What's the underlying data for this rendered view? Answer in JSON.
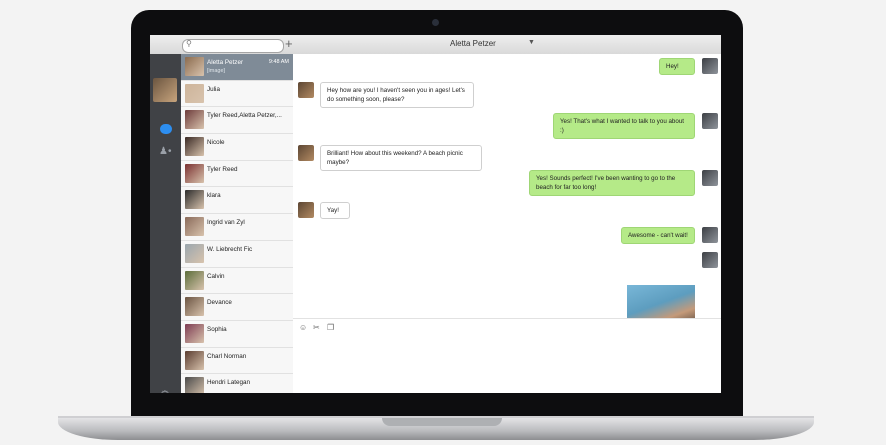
{
  "window": {
    "title": "Aletta Petzer"
  },
  "search": {
    "placeholder": ""
  },
  "conversations": [
    {
      "name": "Aletta Petzer",
      "preview": "[image]",
      "time": "9:48 AM",
      "active": true,
      "color": "#8b6b4e"
    },
    {
      "name": "Julia",
      "color": "#cdb49a"
    },
    {
      "name": "Tyler Reed,Aletta Petzer,...",
      "color": "#6d3b3b"
    },
    {
      "name": "Nicole",
      "color": "#3a2a25"
    },
    {
      "name": "Tyler Reed",
      "color": "#7a3030"
    },
    {
      "name": "klara",
      "color": "#2b2b2b"
    },
    {
      "name": "Ingrid van Zyl",
      "color": "#8a6a5a"
    },
    {
      "name": "W. Liebrecht Fic",
      "color": "#9aa6ae"
    },
    {
      "name": "Calvin",
      "color": "#5b6d3a"
    },
    {
      "name": "Devance",
      "color": "#6b5442"
    },
    {
      "name": "Sophia",
      "color": "#7d3b52"
    },
    {
      "name": "Charl Norman",
      "color": "#5a3c30"
    },
    {
      "name": "Hendri Lategan",
      "color": "#4a4a4a"
    }
  ],
  "messages": [
    {
      "dir": "out",
      "text": "Hey!"
    },
    {
      "dir": "in",
      "text": "Hey how are you! I haven't seen you in ages! Let's do something soon, please?"
    },
    {
      "dir": "out",
      "text": "Yes! That's what I wanted to talk to you about :)"
    },
    {
      "dir": "in",
      "text": "Brilliant! How about this weekend? A beach picnic maybe?"
    },
    {
      "dir": "out",
      "text": "Yes! Sounds perfect! I've been wanting to go to the beach for far too long!"
    },
    {
      "dir": "in",
      "text": "Yay!"
    },
    {
      "dir": "out",
      "text": "Awesome - can't wait!"
    },
    {
      "dir": "out",
      "text": "",
      "image": true
    }
  ],
  "composer": {
    "tools": [
      "smiley-icon",
      "scissors-icon",
      "attachment-icon"
    ]
  }
}
